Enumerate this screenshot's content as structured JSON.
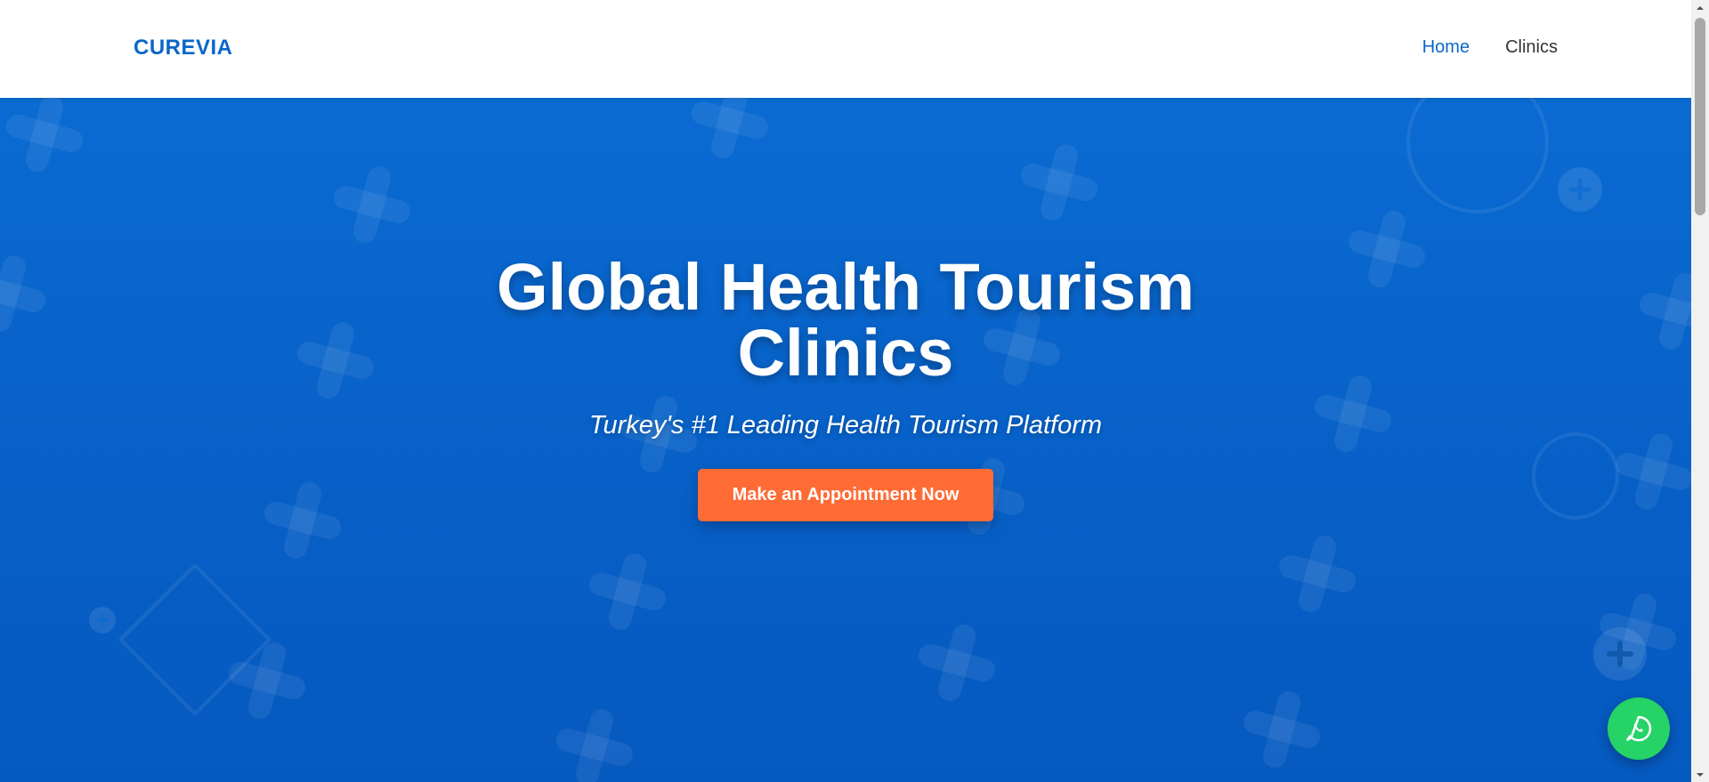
{
  "header": {
    "logo": "CUREVIA",
    "nav": [
      {
        "label": "Home",
        "active": true
      },
      {
        "label": "Clinics",
        "active": false
      }
    ]
  },
  "hero": {
    "title": "Global Health Tourism Clinics",
    "subtitle": "Turkey's #1 Leading Health Tourism Platform",
    "cta_label": "Make an Appointment Now"
  },
  "floating": {
    "whatsapp_icon": "whatsapp-icon"
  },
  "colors": {
    "brand": "#0b66c9",
    "hero_bg": "#0a6bd2",
    "cta": "#ff6b35",
    "whatsapp": "#25d366"
  }
}
